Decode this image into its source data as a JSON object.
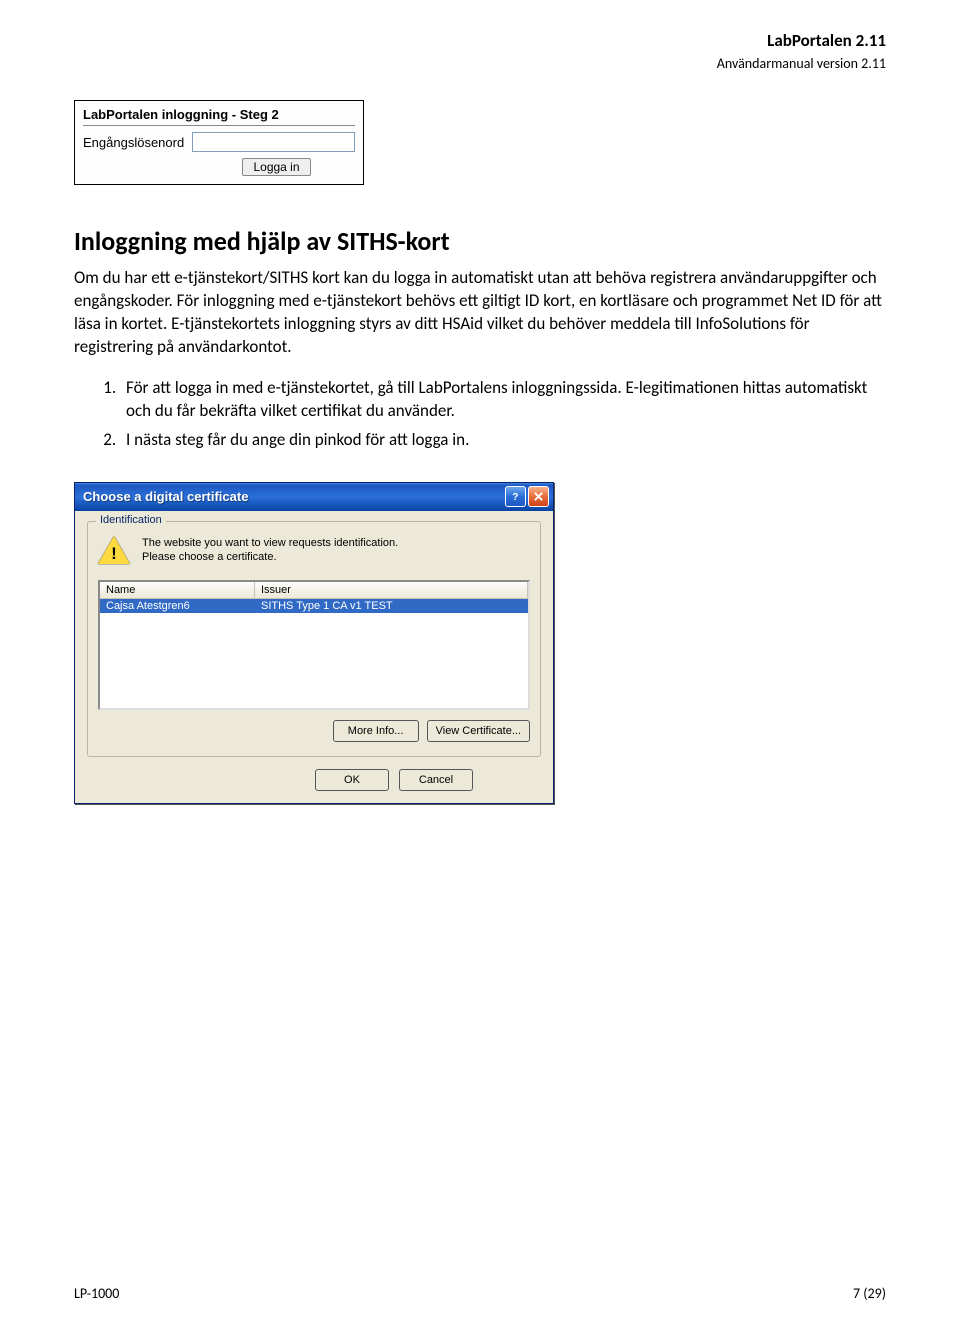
{
  "header": {
    "title": "LabPortalen 2.11",
    "subtitle": "Användarmanual version 2.11"
  },
  "loginbox": {
    "title": "LabPortalen inloggning - Steg 2",
    "otp_label": "Engångslösenord",
    "otp_value": "",
    "login_button": "Logga in"
  },
  "section": {
    "heading": "Inloggning med hjälp av SITHS-kort",
    "paragraph": "Om du har ett e-tjänstekort/SITHS kort kan du logga in automatiskt utan att behöva registrera användaruppgifter och engångskoder. För inloggning med e-tjänstekort behövs ett giltigt ID kort, en kortläsare och programmet Net ID för att läsa in kortet. E-tjänstekortets inloggning styrs av ditt HSAid vilket du behöver meddela till InfoSolutions för registrering på användarkontot.",
    "steps": [
      "För att logga in med e-tjänstekortet, gå till LabPortalens inloggningssida. E-legitimationen hittas automatiskt och du får bekräfta vilket certifikat du använder.",
      "I nästa steg får du ange din pinkod för att logga in."
    ]
  },
  "xp_dialog": {
    "title": "Choose a digital certificate",
    "group_label": "Identification",
    "id_text_1": "The website you want to view requests identification.",
    "id_text_2": "Please choose a certificate.",
    "col_name": "Name",
    "col_issuer": "Issuer",
    "row_name": "Cajsa Atestgren6",
    "row_issuer": "SITHS Type 1 CA v1 TEST",
    "btn_more": "More Info...",
    "btn_viewcert": "View Certificate...",
    "btn_ok": "OK",
    "btn_cancel": "Cancel"
  },
  "footer": {
    "left": "LP-1000",
    "right": "7 (29)"
  }
}
